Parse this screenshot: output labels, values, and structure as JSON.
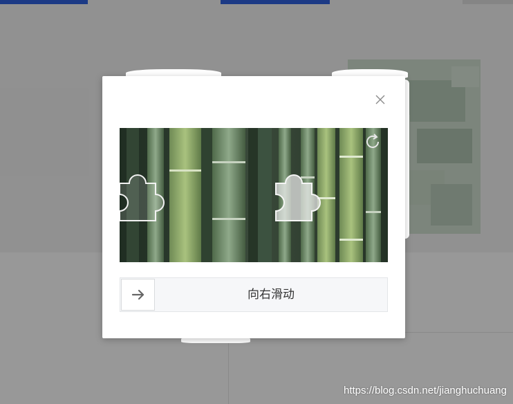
{
  "captcha": {
    "slider_hint": "向右滑动"
  },
  "icons": {
    "close": "close-icon",
    "refresh": "refresh-icon",
    "slider_arrow": "arrow-right-icon",
    "puzzle_piece": "puzzle-piece-icon",
    "puzzle_gap": "puzzle-gap-icon"
  },
  "watermark": "https://blog.csdn.net/jianghuchuang",
  "colors": {
    "accent_bar": "#1447c8",
    "slider_track": "#f6f7f9",
    "slider_text": "#333333"
  }
}
